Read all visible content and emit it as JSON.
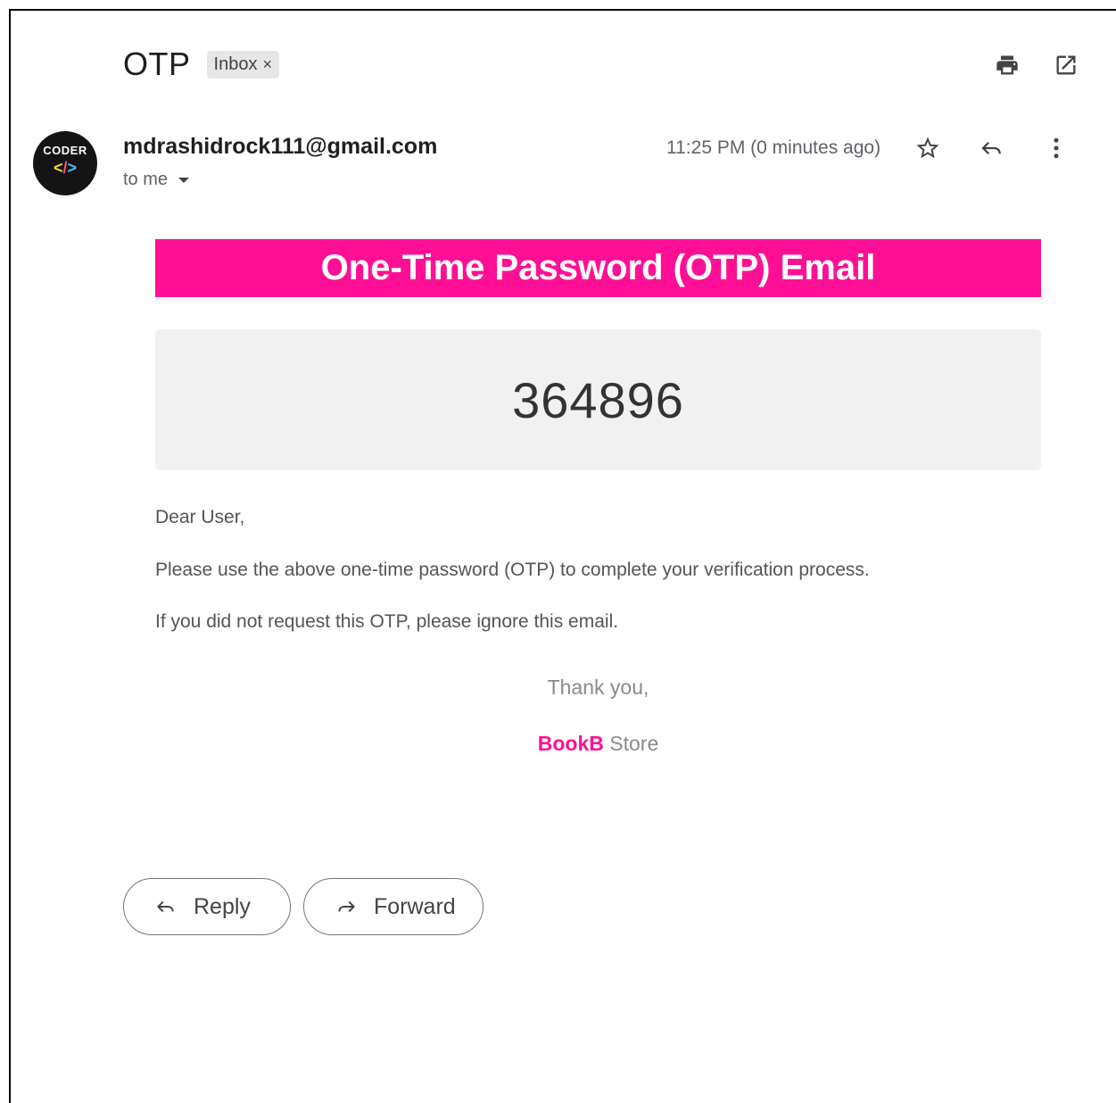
{
  "email": {
    "subject": "OTP",
    "label": "Inbox",
    "label_remove": "×",
    "sender": "mdrashidrock111@gmail.com",
    "recipient": "to me",
    "timestamp": "11:25 PM (0 minutes ago)",
    "avatar": {
      "top_text": "CODER",
      "lt": "<",
      "slash": "/",
      "gt": ">"
    }
  },
  "content": {
    "banner_title": "One-Time Password (OTP) Email",
    "otp_code": "364896",
    "greeting": "Dear User,",
    "paragraph1": "Please use the above one-time password (OTP) to complete your verification process.",
    "paragraph2": "If you did not request this OTP, please ignore this email.",
    "thanks": "Thank you,",
    "brand_highlight": "BookB",
    "brand_rest": " Store"
  },
  "actions": {
    "reply_label": "Reply",
    "forward_label": "Forward"
  },
  "colors": {
    "brand_pink": "#ff0f96",
    "otp_box_bg": "#f1f1f1"
  },
  "icons": [
    "print-icon",
    "open-in-new-window-icon",
    "star-icon",
    "reply-icon",
    "more-vert-icon",
    "forward-icon",
    "dropdown-caret-icon"
  ]
}
